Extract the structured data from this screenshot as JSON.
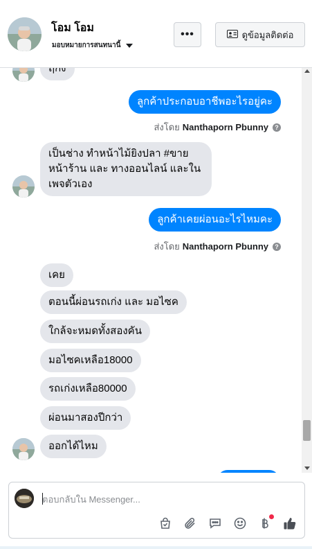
{
  "header": {
    "contact_name": "โอม โอม",
    "assign_label": "มอบหมายการสนทนานี้",
    "more_label": "•••",
    "info_button_label": "ดูข้อมูลติดต่อ"
  },
  "thread": {
    "partial_top": "ฤกัง",
    "messages": [
      {
        "dir": "out",
        "text": "ลูกค้าประกอบอาชีพอะไรอยู่คะ"
      },
      {
        "dir": "out",
        "text": "ลูกค้าเคยผ่อนอะไรไหมคะ"
      }
    ],
    "incoming_multi": "เป็นช่าง ทำหน้าไม้ยิงปลา #ขายหน้าร้าน และ ทางออนไลน์ และในเพจตัวเอง",
    "incoming_group": [
      "เคย",
      "ตอนนี้ผ่อนรถเก่ง และ มอไซค",
      "ใกล้จะหมดทั้งสองคัน",
      "มอไซคเหลือ18000",
      "รถเก่งเหลือ80000",
      "ผ่อนมาสองปีกว่า",
      "ออกได้ไหม"
    ],
    "sent_by_prefix": "ส่งโดย",
    "sent_by_name": "Nanthaporn Pbunny",
    "help_glyph": "?"
  },
  "composer": {
    "placeholder": "ตอบกลับใน Messenger..."
  },
  "icons": {
    "header_more": "more-horizontal-icon",
    "contact_card": "contact-card-icon",
    "tools": [
      "shopping-bag-icon",
      "paperclip-icon",
      "chat-bubble-icon",
      "emoji-icon",
      "baht-payment-icon",
      "thumbs-up-icon"
    ]
  },
  "colors": {
    "outgoing_bubble": "#0084ff",
    "incoming_bubble": "#e4e6eb",
    "notification_dot": "#f02849"
  }
}
